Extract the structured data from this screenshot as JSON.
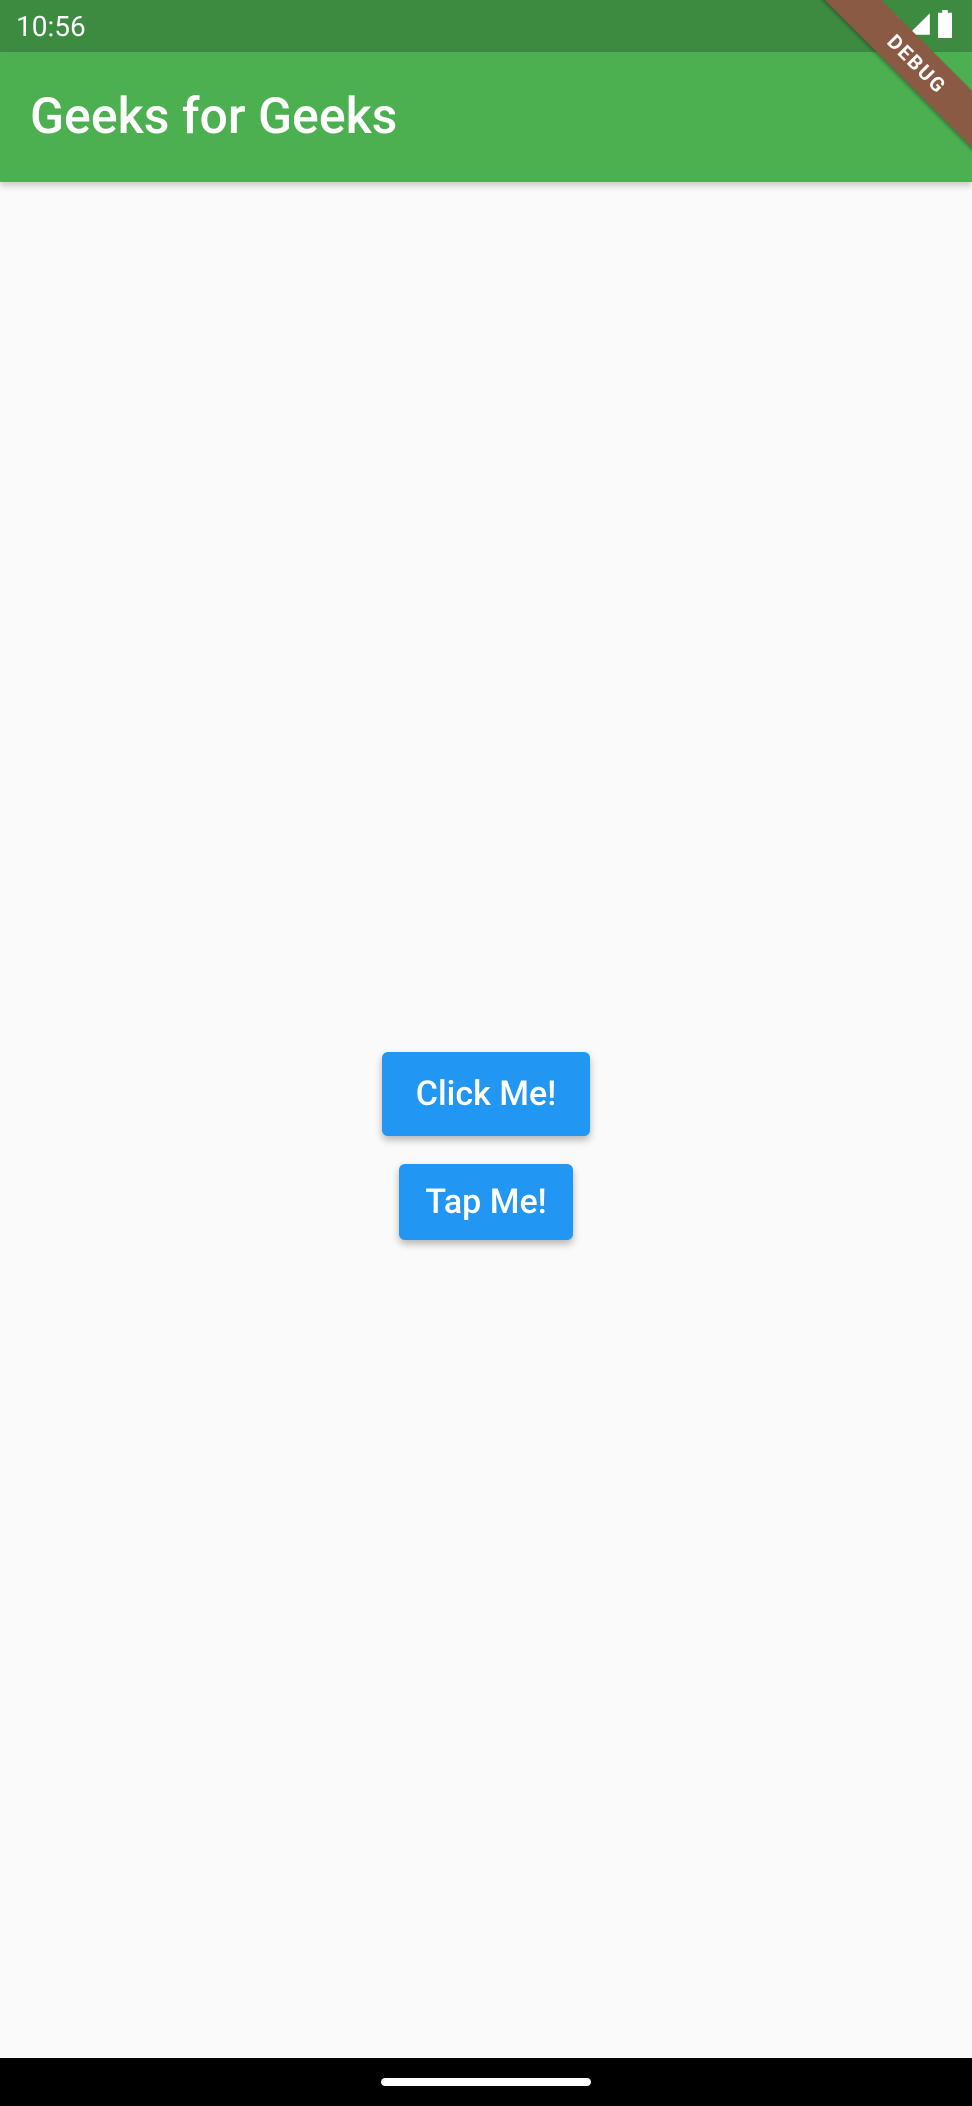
{
  "status_bar": {
    "time": "10:56"
  },
  "app_bar": {
    "title": "Geeks for Geeks"
  },
  "debug_banner": {
    "label": "DEBUG"
  },
  "buttons": {
    "primary": "Click Me!",
    "secondary": "Tap Me!"
  }
}
